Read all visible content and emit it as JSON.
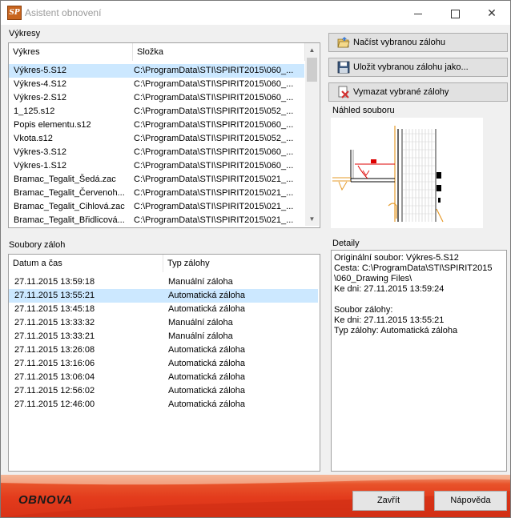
{
  "window": {
    "title": "Asistent obnovení"
  },
  "drawings": {
    "group_label": "Výkresy",
    "columns": [
      "Výkres",
      "Složka"
    ],
    "rows": [
      {
        "name": "Výkres-5.S12",
        "folder": "C:\\ProgramData\\STI\\SPIRIT2015\\060_...",
        "selected": true
      },
      {
        "name": "Výkres-4.S12",
        "folder": "C:\\ProgramData\\STI\\SPIRIT2015\\060_..."
      },
      {
        "name": "Výkres-2.S12",
        "folder": "C:\\ProgramData\\STI\\SPIRIT2015\\060_..."
      },
      {
        "name": "1_125.s12",
        "folder": "C:\\ProgramData\\STI\\SPIRIT2015\\052_..."
      },
      {
        "name": "Popis elementu.s12",
        "folder": "C:\\ProgramData\\STI\\SPIRIT2015\\060_..."
      },
      {
        "name": "Vkota.s12",
        "folder": "C:\\ProgramData\\STI\\SPIRIT2015\\052_..."
      },
      {
        "name": "Výkres-3.S12",
        "folder": "C:\\ProgramData\\STI\\SPIRIT2015\\060_..."
      },
      {
        "name": "Výkres-1.S12",
        "folder": "C:\\ProgramData\\STI\\SPIRIT2015\\060_..."
      },
      {
        "name": "Bramac_Tegalit_Šedá.zac",
        "folder": "C:\\ProgramData\\STI\\SPIRIT2015\\021_..."
      },
      {
        "name": "Bramac_Tegalit_Červenoh...",
        "folder": "C:\\ProgramData\\STI\\SPIRIT2015\\021_..."
      },
      {
        "name": "Bramac_Tegalit_Cihlová.zac",
        "folder": "C:\\ProgramData\\STI\\SPIRIT2015\\021_..."
      },
      {
        "name": "Bramac_Tegalit_Břidlicová...",
        "folder": "C:\\ProgramData\\STI\\SPIRIT2015\\021_..."
      }
    ]
  },
  "actions": {
    "load": "Načíst vybranou zálohu",
    "save_as": "Uložit vybranou zálohu jako...",
    "delete": "Vymazat vybrané zálohy"
  },
  "preview": {
    "label": "Náhled souboru"
  },
  "backups": {
    "group_label": "Soubory záloh",
    "columns": [
      "Datum a čas",
      "Typ zálohy"
    ],
    "rows": [
      {
        "datetime": "27.11.2015 13:59:18",
        "type": "Manuální záloha"
      },
      {
        "datetime": "27.11.2015 13:55:21",
        "type": "Automatická záloha",
        "selected": true
      },
      {
        "datetime": "27.11.2015 13:45:18",
        "type": "Automatická záloha"
      },
      {
        "datetime": "27.11.2015 13:33:32",
        "type": "Manuální záloha"
      },
      {
        "datetime": "27.11.2015 13:33:21",
        "type": "Manuální záloha"
      },
      {
        "datetime": "27.11.2015 13:26:08",
        "type": "Automatická záloha"
      },
      {
        "datetime": "27.11.2015 13:16:06",
        "type": "Automatická záloha"
      },
      {
        "datetime": "27.11.2015 13:06:04",
        "type": "Automatická záloha"
      },
      {
        "datetime": "27.11.2015 12:56:02",
        "type": "Automatická záloha"
      },
      {
        "datetime": "27.11.2015 12:46:00",
        "type": "Automatická záloha"
      }
    ]
  },
  "details": {
    "label": "Detaily",
    "text": "Originální soubor: Výkres-5.S12\nCesta: C:\\ProgramData\\STI\\SPIRIT2015\n\\060_Drawing Files\\\nKe dni: 27.11.2015 13:59:24\n\nSoubor zálohy:\nKe dni: 27.11.2015 13:55:21\nTyp zálohy: Automatická záloha"
  },
  "footer": {
    "brand": "OBNOVA",
    "close_label": "Zavřít",
    "help_label": "Nápověda"
  },
  "colors": {
    "selection": "#cce8ff",
    "footer_accent": "#e33b1c"
  }
}
